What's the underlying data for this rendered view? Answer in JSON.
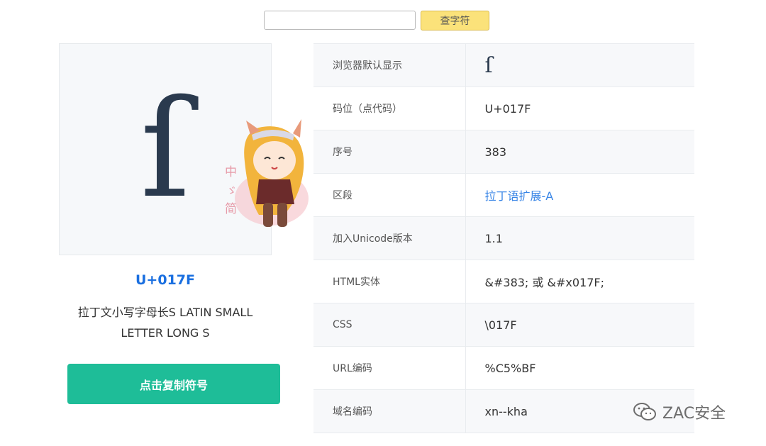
{
  "search": {
    "value": "",
    "placeholder": "",
    "button_label": "查字符"
  },
  "preview": {
    "glyph": "ſ",
    "codepoint": "U+017F",
    "name": "拉丁文小写字母长S LATIN SMALL LETTER LONG S",
    "copy_label": "点击复制符号"
  },
  "mascot": {
    "vertical_text": "中 ゞ 简"
  },
  "table": {
    "rows": [
      {
        "label": "浏览器默认显示",
        "value": "ſ"
      },
      {
        "label": "码位（点代码）",
        "value": "U+017F"
      },
      {
        "label": "序号",
        "value": "383"
      },
      {
        "label": "区段",
        "value": "拉丁语扩展-A"
      },
      {
        "label": "加入Unicode版本",
        "value": "1.1"
      },
      {
        "label": "HTML实体",
        "value": "&#383; 或 &#x017F;"
      },
      {
        "label": "CSS",
        "value": "\\017F"
      },
      {
        "label": "URL编码",
        "value": "%C5%BF"
      },
      {
        "label": "域名编码",
        "value": "xn--kha"
      }
    ]
  },
  "watermark": {
    "text": "ZAC安全",
    "icon": "wechat-icon"
  }
}
